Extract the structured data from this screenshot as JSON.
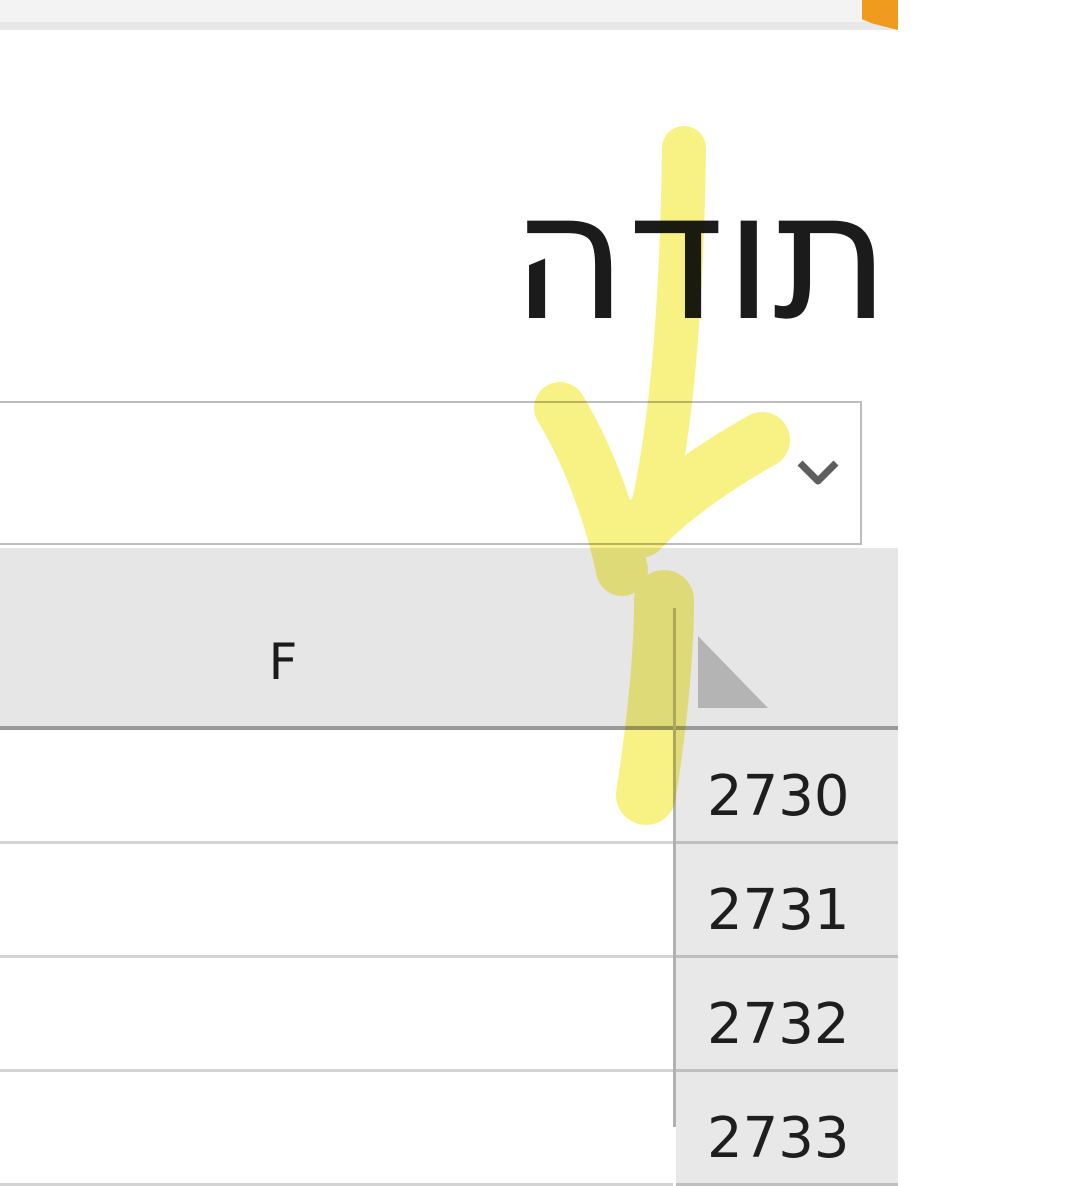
{
  "heading": "תודה",
  "column_header": {
    "label": "F"
  },
  "rows": [
    {
      "number": "2730"
    },
    {
      "number": "2731"
    },
    {
      "number": "2732"
    },
    {
      "number": "2733"
    }
  ],
  "colors": {
    "accent": "#f09a1e",
    "highlighter": "#f5ed55",
    "header_bg": "#e6e6e6"
  }
}
